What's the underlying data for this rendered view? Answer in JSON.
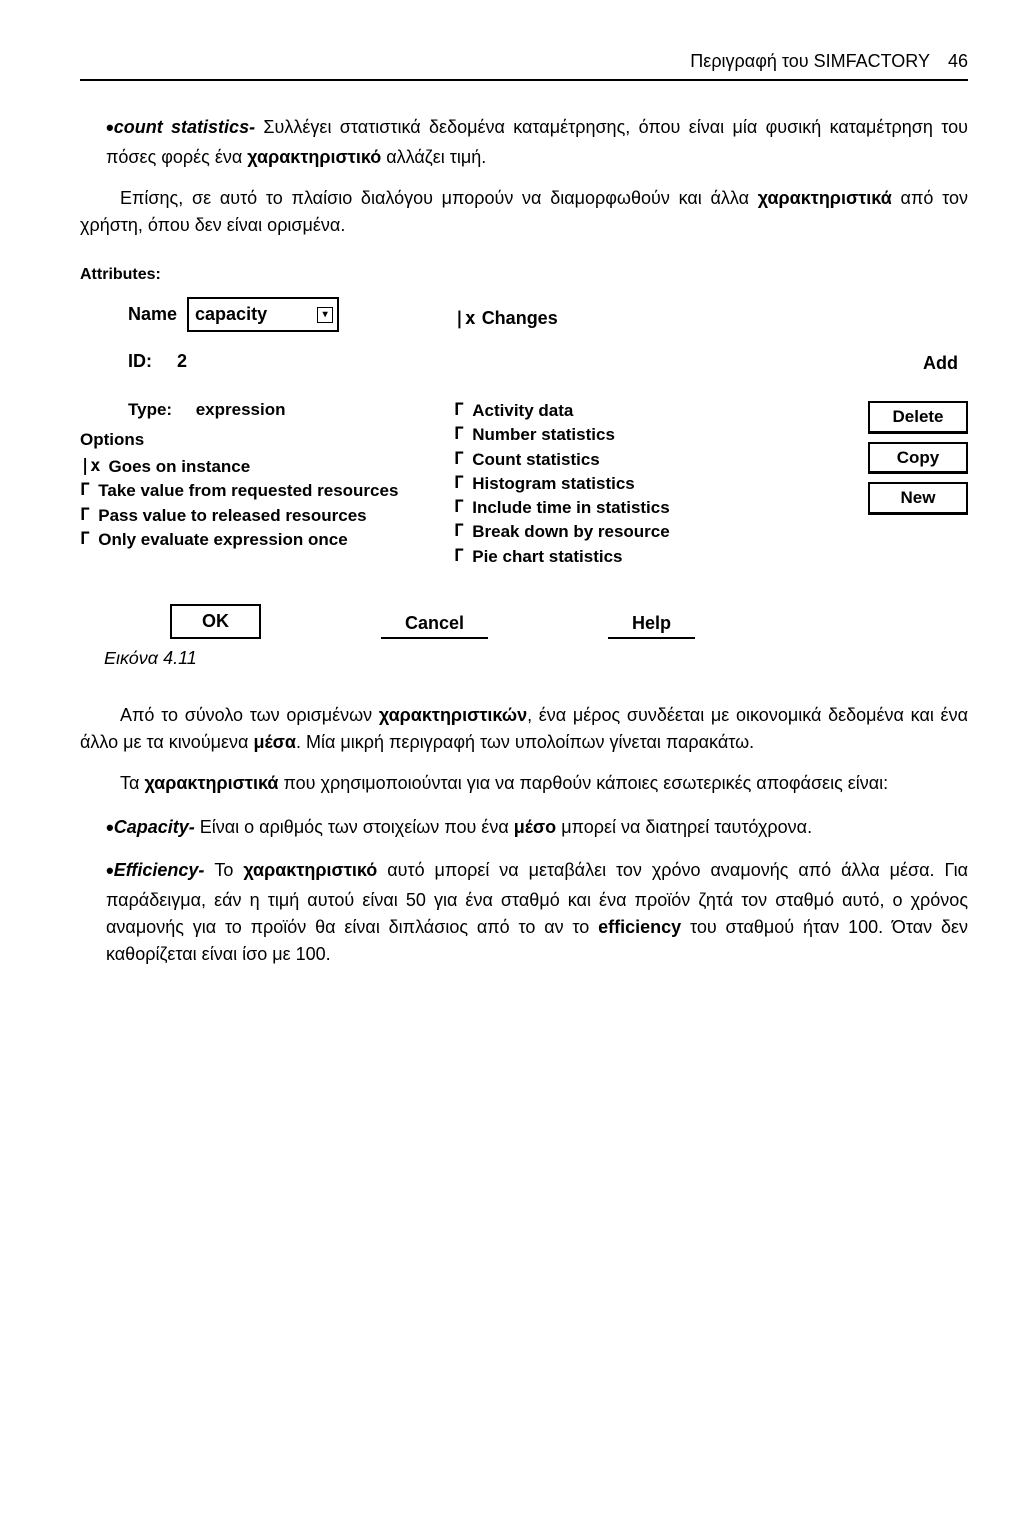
{
  "header": {
    "title": "Περιγραφή του SIMFACTORY",
    "page": "46"
  },
  "intro": {
    "bullet_title": "count statistics-",
    "bullet_body": " Συλλέγει στατιστικά δεδομένα καταμέτρησης, όπου είναι μία φυσική καταμέτρηση του πόσες φορές ένα ",
    "bullet_bold": "χαρακτηριστικό",
    "bullet_tail": " αλλάζει τιμή.",
    "p2a": "Επίσης, σε αυτό το πλαίσιο διαλόγου μπορούν να διαμορφωθούν και άλλα ",
    "p2bold": "χαρακτηριστικά",
    "p2b": " από τον χρήστη, όπου δεν είναι ορισμένα."
  },
  "attributes": {
    "section_label": "Attributes:",
    "name_label": "Name",
    "name_value": "capacity",
    "changes_label": "Changes",
    "id_label": "ID:",
    "id_value": "2",
    "add_label": "Add",
    "type_label": "Type:",
    "type_value": "expression",
    "options_label": "Options",
    "left_opts": [
      {
        "mark": "|x",
        "text": "Goes on instance"
      },
      {
        "mark": "Γ",
        "text": "Take value from requested resources"
      },
      {
        "mark": "Γ",
        "text": "Pass value to released resources"
      },
      {
        "mark": "Γ",
        "text": "Only evaluate expression once"
      }
    ],
    "mid_opts": [
      {
        "mark": "Γ",
        "text": "Activity data"
      },
      {
        "mark": "Γ",
        "text": "Number statistics"
      },
      {
        "mark": "Γ",
        "text": "Count statistics"
      },
      {
        "mark": "Γ",
        "text": "Histogram statistics"
      },
      {
        "mark": "Γ",
        "text": "Include time in statistics"
      },
      {
        "mark": "Γ",
        "text": "Break down by resource"
      },
      {
        "mark": "Γ",
        "text": "Pie chart statistics"
      }
    ],
    "buttons": {
      "delete": "Delete",
      "copy": "Copy",
      "new": "New"
    },
    "footer": {
      "ok": "OK",
      "cancel": "Cancel",
      "help": "Help"
    },
    "caption": "Εικόνα 4.11"
  },
  "body": {
    "p1a": "Από το σύνολο των ορισμένων ",
    "p1bold1": "χαρακτηριστικών",
    "p1b": ", ένα μέρος συνδέεται με οικονομικά δεδομένα και ένα άλλο με τα κινούμενα ",
    "p1bold2": "μέσα",
    "p1c": ". Μία μικρή περιγραφή των υπολοίπων γίνεται παρακάτω.",
    "p2a": "Τα ",
    "p2bold": "χαρακτηριστικά",
    "p2b": " που χρησιμοποιούνται για να παρθούν κάποιες εσωτερικές αποφάσεις είναι:",
    "cap_title": "Capacity-",
    "cap_body_a": " Είναι ο αριθμός των στοιχείων που ένα ",
    "cap_bold": "μέσο",
    "cap_body_b": " μπορεί να διατηρεί ταυτόχρονα.",
    "eff_title": "Efficiency-",
    "eff_body_a": " Το ",
    "eff_bold": "χαρακτηριστικό",
    "eff_body_b": " αυτό μπορεί να μεταβάλει τον χρόνο αναμονής από άλλα μέσα. Για παράδειγμα, εάν η τιμή αυτού είναι 50 για ένα σταθμό και ένα προϊόν ζητά τον σταθμό αυτό, ο χρόνος αναμονής για το προϊόν θα είναι διπλάσιος από το αν το ",
    "eff_bold2": "efficiency",
    "eff_body_c": " του σταθμού ήταν 100. Όταν δεν καθορίζεται είναι ίσο με 100."
  }
}
